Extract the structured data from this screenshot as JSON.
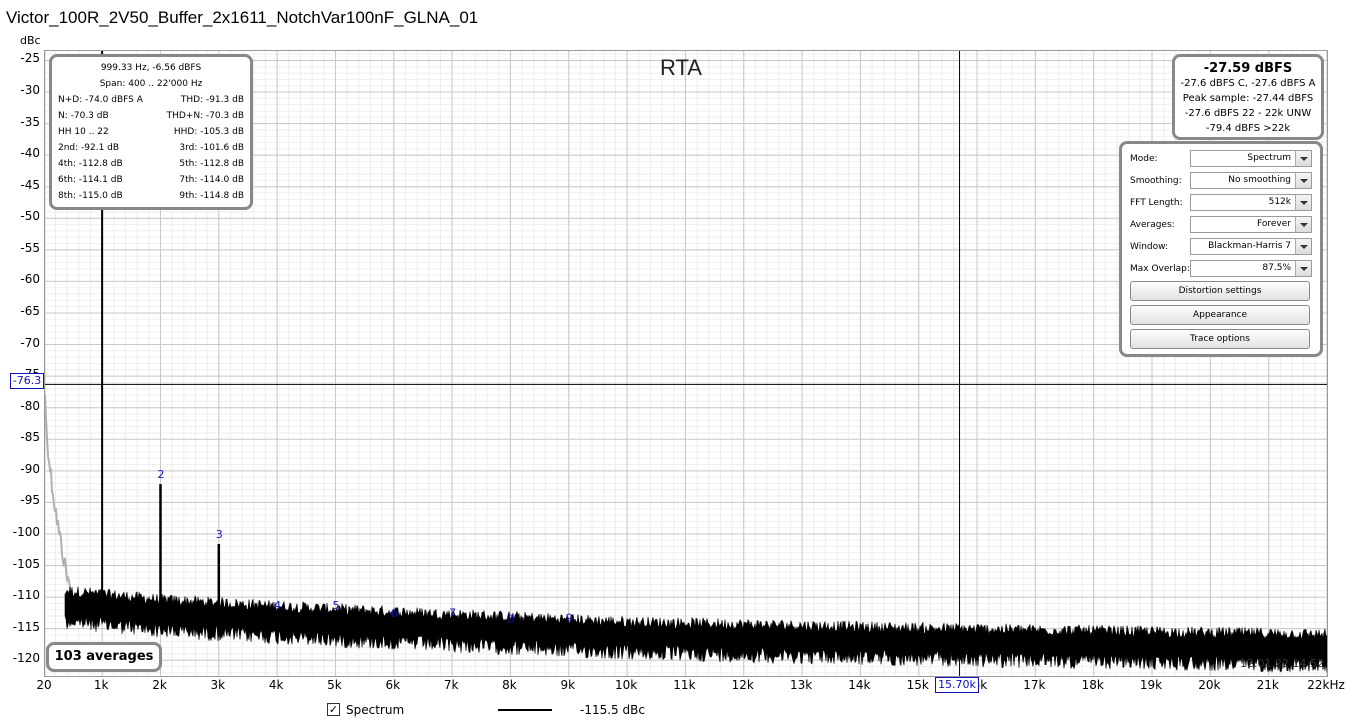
{
  "window_title": "Victor_100R_2V50_Buffer_2x1611_NotchVar100nF_GLNA_01",
  "y_unit": "dBc",
  "rta_label": "RTA",
  "cursor": {
    "y_value": "-76.3",
    "x_value": "15.70k"
  },
  "chart_data": {
    "type": "line",
    "title": "RTA",
    "ylabel": "dBc",
    "ylim": [
      -122.5,
      -23.5
    ],
    "xlim": [
      20,
      22000
    ],
    "y_ticks": [
      "-25",
      "-30",
      "-35",
      "-40",
      "-45",
      "-50",
      "-55",
      "-60",
      "-65",
      "-70",
      "-75",
      "-80",
      "-85",
      "-90",
      "-95",
      "-100",
      "-105",
      "-110",
      "-115",
      "-120"
    ],
    "x_ticks": [
      "20",
      "1k",
      "2k",
      "3k",
      "4k",
      "5k",
      "6k",
      "7k",
      "8k",
      "9k",
      "10k",
      "11k",
      "12k",
      "13k",
      "14k",
      "15k",
      "16k",
      "17k",
      "18k",
      "19k",
      "20k",
      "21k",
      "22kHz"
    ],
    "series": [
      {
        "name": "Spectrum",
        "color": "#000000"
      }
    ],
    "noise_floor": {
      "x": [
        300,
        2000,
        5000,
        10000,
        15000,
        22000
      ],
      "y": [
        -111,
        -112.5,
        -114,
        -116,
        -117,
        -118
      ]
    },
    "harmonics": [
      {
        "label": "2",
        "freq": 2000,
        "level": -92.1
      },
      {
        "label": "3",
        "freq": 3000,
        "level": -101.6
      },
      {
        "label": "4",
        "freq": 4000,
        "level": -112.8
      },
      {
        "label": "5",
        "freq": 5000,
        "level": -112.8
      },
      {
        "label": "6",
        "freq": 6000,
        "level": -114.1
      },
      {
        "label": "7",
        "freq": 7000,
        "level": -114.0
      },
      {
        "label": "8",
        "freq": 8000,
        "level": -115.0
      },
      {
        "label": "9",
        "freq": 9000,
        "level": -114.8
      }
    ],
    "fundamental": {
      "freq": 999.33,
      "level": -6.56
    }
  },
  "stats": {
    "line1": "999.33 Hz, -6.56 dBFS",
    "line2": "Span: 400 .. 22'000 Hz",
    "rows": [
      {
        "l": "N+D: -74.0 dBFS A",
        "r": "THD: -91.3 dB"
      },
      {
        "l": "N: -70.3 dB",
        "r": "THD+N: -70.3 dB"
      },
      {
        "l": "HH 10 .. 22",
        "r": "HHD: -105.3 dB"
      },
      {
        "l": "2nd: -92.1 dB",
        "r": "3rd: -101.6 dB"
      },
      {
        "l": "4th: -112.8 dB",
        "r": "5th: -112.8 dB"
      },
      {
        "l": "6th: -114.1 dB",
        "r": "7th: -114.0 dB"
      },
      {
        "l": "8th: -115.0 dB",
        "r": "9th: -114.8 dB"
      }
    ]
  },
  "level": {
    "main": "-27.59 dBFS",
    "lines": [
      "-27.6 dBFS C, -27.6 dBFS A",
      "Peak sample: -27.44 dBFS",
      "-27.6 dBFS 22 - 22k UNW",
      "-79.4 dBFS >22k"
    ]
  },
  "controls": [
    {
      "label": "Mode:",
      "value": "Spectrum"
    },
    {
      "label": "Smoothing:",
      "value": "No  smoothing"
    },
    {
      "label": "FFT Length:",
      "value": "512k"
    },
    {
      "label": "Averages:",
      "value": "Forever"
    },
    {
      "label": "Window:",
      "value": "Blackman-Harris 7"
    },
    {
      "label": "Max Overlap:",
      "value": "87.5%"
    }
  ],
  "buttons": [
    "Distortion settings",
    "Appearance",
    "Trace options"
  ],
  "averages_label": "103 averages",
  "timestamp": "12.01.22 14:52",
  "legend": {
    "checkbox": "✓",
    "name": "Spectrum",
    "value": "-115.5 dBc"
  }
}
